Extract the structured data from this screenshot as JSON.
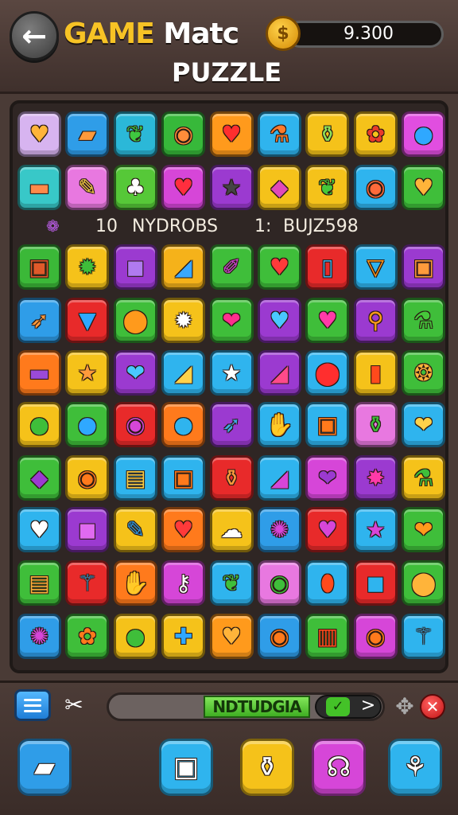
{
  "header": {
    "title_word1": "GAME",
    "title_word2": "Matc",
    "title_line2": "PUZZLE",
    "score": "9.300",
    "back_icon": "back-arrow-icon",
    "coin_icon": "coin-icon"
  },
  "info_row": {
    "icon": "candy-icon",
    "count": "10",
    "label1": "NYDROBS",
    "num2": "1:",
    "label2": "BUJZ598"
  },
  "board": {
    "rows": [
      [
        {
          "bg": "#d7b4f0",
          "icon": "heart-icon",
          "color": "#ffb43a"
        },
        {
          "bg": "#2f9de8",
          "icon": "bread-icon",
          "color": "#ff9a3c"
        },
        {
          "bg": "#2bb8d8",
          "icon": "leaf-icon",
          "color": "#3fc840"
        },
        {
          "bg": "#37b83a",
          "icon": "donut-icon",
          "color": "#ff8c3a"
        },
        {
          "bg": "#ff9a1c",
          "icon": "heart-icon",
          "color": "#ff2e2e"
        },
        {
          "bg": "#2fb4ee",
          "icon": "potion-icon",
          "color": "#ff7a2a"
        },
        {
          "bg": "#f5c21a",
          "icon": "bottle-icon",
          "color": "#8de05a"
        },
        {
          "bg": "#f5c21a",
          "icon": "candy-icon",
          "color": "#e83a2a"
        },
        {
          "bg": "#e14ee0",
          "icon": "lollipop-icon",
          "color": "#2fa8ff"
        }
      ],
      [
        {
          "bg": "#38c8c8",
          "icon": "stick-icon",
          "color": "#ff8a4a"
        },
        {
          "bg": "#e878e0",
          "icon": "pencil-icon",
          "color": "#ffd24a"
        },
        {
          "bg": "#56c838",
          "icon": "bell-icon",
          "color": "#ffffff"
        },
        {
          "bg": "#d646d8",
          "icon": "heart-icon",
          "color": "#ff2e3e"
        },
        {
          "bg": "#9b3ad0",
          "icon": "star-icon",
          "color": "#444444"
        },
        {
          "bg": "#f5c21a",
          "icon": "gem-icon",
          "color": "#e04ab8"
        },
        {
          "bg": "#f5c21a",
          "icon": "leaf-icon",
          "color": "#46c83a"
        },
        {
          "bg": "#2fb4ee",
          "icon": "donut-icon",
          "color": "#ff6a3a"
        },
        {
          "bg": "#3fbe3a",
          "icon": "heart-icon",
          "color": "#ffb43a"
        }
      ],
      [
        {
          "bg": "#3bb838",
          "icon": "box-icon",
          "color": "#e05a2a"
        },
        {
          "bg": "#f5c21a",
          "icon": "gear-icon",
          "color": "#3fbe3a"
        },
        {
          "bg": "#9b3ad0",
          "icon": "cube-icon",
          "color": "#b07af0"
        },
        {
          "bg": "#f5b21a",
          "icon": "candy-stick-icon",
          "color": "#3aa8ff"
        },
        {
          "bg": "#3fbe3a",
          "icon": "paint-brush-icon",
          "color": "#d646d8"
        },
        {
          "bg": "#3fbe3a",
          "icon": "heart-icon",
          "color": "#ff3a3a"
        },
        {
          "bg": "#e82a2a",
          "icon": "door-icon",
          "color": "#3fa8e0"
        },
        {
          "bg": "#2fb4ee",
          "icon": "cup-icon",
          "color": "#ff9a1c"
        },
        {
          "bg": "#9b3ad0",
          "icon": "box-icon",
          "color": "#ff9a3c"
        }
      ],
      [
        {
          "bg": "#2f9de8",
          "icon": "rocket-icon",
          "color": "#ff9a3c"
        },
        {
          "bg": "#e82a2a",
          "icon": "ice-cream-icon",
          "color": "#2fa8ff"
        },
        {
          "bg": "#3fbe3a",
          "icon": "ball-icon",
          "color": "#ff9a1c"
        },
        {
          "bg": "#f5c21a",
          "icon": "gear-icon",
          "color": "#ffffff"
        },
        {
          "bg": "#3fbe3a",
          "icon": "apple-icon",
          "color": "#ff2e8e"
        },
        {
          "bg": "#9b3ad0",
          "icon": "heart-icon",
          "color": "#4ac8ff"
        },
        {
          "bg": "#3fbe3a",
          "icon": "heart-icon",
          "color": "#ff3aa8"
        },
        {
          "bg": "#9b3ad0",
          "icon": "bone-icon",
          "color": "#ff9a1c"
        },
        {
          "bg": "#3fbe3a",
          "icon": "potion-icon",
          "color": "#46c83a"
        }
      ],
      [
        {
          "bg": "#ff7a1c",
          "icon": "stick-icon",
          "color": "#9b4ad8"
        },
        {
          "bg": "#f5c21a",
          "icon": "star-icon",
          "color": "#ff9a3c"
        },
        {
          "bg": "#9b3ad0",
          "icon": "apple-icon",
          "color": "#4ac8ff"
        },
        {
          "bg": "#2fb4ee",
          "icon": "candy-stick-icon",
          "color": "#ffd24a"
        },
        {
          "bg": "#2fb4ee",
          "icon": "star-icon",
          "color": "#ffffff"
        },
        {
          "bg": "#9b3ad0",
          "icon": "candy-stick-icon",
          "color": "#ff4a8a"
        },
        {
          "bg": "#2fb4ee",
          "icon": "ball-icon",
          "color": "#ff2e2e"
        },
        {
          "bg": "#f5c21a",
          "icon": "barrel-icon",
          "color": "#ff4a1c"
        },
        {
          "bg": "#3fbe3a",
          "icon": "cookie-icon",
          "color": "#ffb43a"
        }
      ],
      [
        {
          "bg": "#f5c21a",
          "icon": "lollipop-icon",
          "color": "#3fbe3a"
        },
        {
          "bg": "#3fbe3a",
          "icon": "lollipop-icon",
          "color": "#2fa8ff"
        },
        {
          "bg": "#e82a2a",
          "icon": "donut-icon",
          "color": "#d646d8"
        },
        {
          "bg": "#ff7a1c",
          "icon": "lollipop-icon",
          "color": "#2fb4ee"
        },
        {
          "bg": "#9b3ad0",
          "icon": "rocket-icon",
          "color": "#3fa8e0"
        },
        {
          "bg": "#2fb4ee",
          "icon": "glove-icon",
          "color": "#ffd24a"
        },
        {
          "bg": "#2fb4ee",
          "icon": "box-icon",
          "color": "#ff7a1c"
        },
        {
          "bg": "#e878e0",
          "icon": "bottle-icon",
          "color": "#3fbe3a"
        },
        {
          "bg": "#2fb4ee",
          "icon": "apple-icon",
          "color": "#ffd24a"
        }
      ],
      [
        {
          "bg": "#3fbe3a",
          "icon": "gem-icon",
          "color": "#9b3ad0"
        },
        {
          "bg": "#f5c21a",
          "icon": "donut-icon",
          "color": "#ff7a1c"
        },
        {
          "bg": "#2fb4ee",
          "icon": "ruler-icon",
          "color": "#ffd24a"
        },
        {
          "bg": "#2fb4ee",
          "icon": "box-icon",
          "color": "#ff7a1c"
        },
        {
          "bg": "#e82a2a",
          "icon": "bottle-icon",
          "color": "#ff9a3c"
        },
        {
          "bg": "#2fb4ee",
          "icon": "candy-stick-icon",
          "color": "#d646d8"
        },
        {
          "bg": "#d646d8",
          "icon": "apple-icon",
          "color": "#9b3ad0"
        },
        {
          "bg": "#9b3ad0",
          "icon": "star-burst-icon",
          "color": "#ff3aa8"
        },
        {
          "bg": "#f5c21a",
          "icon": "potion-icon",
          "color": "#3fbe3a"
        }
      ],
      [
        {
          "bg": "#2fb4ee",
          "icon": "heart-icon",
          "color": "#ffffff"
        },
        {
          "bg": "#9b3ad0",
          "icon": "cube-icon",
          "color": "#e06af0"
        },
        {
          "bg": "#f5c21a",
          "icon": "pencil-icon",
          "color": "#2f9de8"
        },
        {
          "bg": "#ff7a1c",
          "icon": "heart-icon",
          "color": "#ff3a3a"
        },
        {
          "bg": "#f5c21a",
          "icon": "cloud-icon",
          "color": "#ffffff"
        },
        {
          "bg": "#2f9de8",
          "icon": "virus-icon",
          "color": "#d646d8"
        },
        {
          "bg": "#e82a2a",
          "icon": "heart-icon",
          "color": "#d646d8"
        },
        {
          "bg": "#2fb4ee",
          "icon": "star-icon",
          "color": "#d646d8"
        },
        {
          "bg": "#3fbe3a",
          "icon": "apple-icon",
          "color": "#ff9a1c"
        }
      ],
      [
        {
          "bg": "#3fbe3a",
          "icon": "ruler-icon",
          "color": "#ffb43a"
        },
        {
          "bg": "#e82a2a",
          "icon": "wand-icon",
          "color": "#3fa8e0"
        },
        {
          "bg": "#ff7a1c",
          "icon": "glove-icon",
          "color": "#ffd24a"
        },
        {
          "bg": "#d646d8",
          "icon": "key-icon",
          "color": "#ffffff"
        },
        {
          "bg": "#2fb4ee",
          "icon": "leaf-icon",
          "color": "#3fbe3a"
        },
        {
          "bg": "#e878e0",
          "icon": "donut-icon",
          "color": "#3fbe3a"
        },
        {
          "bg": "#2fb4ee",
          "icon": "egg-icon",
          "color": "#ff4a1c"
        },
        {
          "bg": "#e82a2a",
          "icon": "cube-icon",
          "color": "#2fb4ee"
        },
        {
          "bg": "#3fbe3a",
          "icon": "ball-icon",
          "color": "#ffb43a"
        }
      ],
      [
        {
          "bg": "#2f9de8",
          "icon": "virus-icon",
          "color": "#d646d8"
        },
        {
          "bg": "#3fbe3a",
          "icon": "candy-icon",
          "color": "#ff7a1c"
        },
        {
          "bg": "#f5c21a",
          "icon": "lollipop-icon",
          "color": "#3fbe3a"
        },
        {
          "bg": "#f5c21a",
          "icon": "cross-icon",
          "color": "#2fa8ff"
        },
        {
          "bg": "#ff9a1c",
          "icon": "heart-icon",
          "color": "#ffb43a"
        },
        {
          "bg": "#2f9de8",
          "icon": "donut-icon",
          "color": "#ff7a1c"
        },
        {
          "bg": "#3fbe3a",
          "icon": "book-icon",
          "color": "#ff4a1c"
        },
        {
          "bg": "#d646d8",
          "icon": "donut-icon",
          "color": "#ff7a1c"
        },
        {
          "bg": "#2fb4ee",
          "icon": "wand-icon",
          "color": "#3fa8e0"
        }
      ]
    ]
  },
  "bottom_bar": {
    "menu_icon": "menu-icon",
    "tools_icon": "tools-icon",
    "progress_label": "NDTUDGIA",
    "check_icon": "check-icon",
    "arrow_glyph": ">",
    "move_icon": "move-icon",
    "close_glyph": "✕"
  },
  "tools": [
    {
      "bg": "#2f9de8",
      "icon": "gold-bar-icon"
    },
    {
      "bg": "#2fb4ee",
      "icon": "box-icon"
    },
    {
      "bg": "#f5c21a",
      "icon": "bottle-icon"
    },
    {
      "bg": "#d646d8",
      "icon": "headphones-icon"
    },
    {
      "bg": "#2fb4ee",
      "icon": "spray-icon"
    }
  ]
}
